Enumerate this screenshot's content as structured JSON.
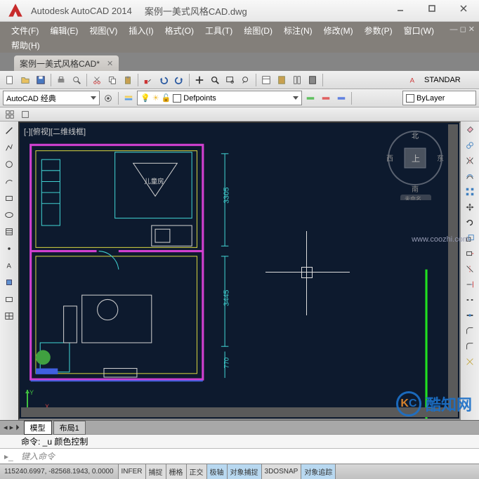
{
  "title": {
    "app": "Autodesk AutoCAD 2014",
    "file": "案例一美式风格CAD.dwg"
  },
  "menu": [
    "文件(F)",
    "编辑(E)",
    "视图(V)",
    "插入(I)",
    "格式(O)",
    "工具(T)",
    "绘图(D)",
    "标注(N)",
    "修改(M)",
    "参数(P)",
    "窗口(W)",
    "帮助(H)"
  ],
  "file_tab": {
    "name": "案例一美式风格CAD*"
  },
  "workspace": {
    "current": "AutoCAD 经典"
  },
  "layer": {
    "current": "Defpoints"
  },
  "color_combo": {
    "value": "ByLayer"
  },
  "style_combo": {
    "value": "STANDAR"
  },
  "view_label": "[-][俯视][二维线框]",
  "viewcube": {
    "n": "北",
    "s": "南",
    "e": "东",
    "w": "西",
    "face": "上",
    "label": "未命名"
  },
  "tabs": {
    "model": "模型",
    "layout1": "布局1"
  },
  "command": {
    "history": "命令: _u 颜色控制",
    "prompt": "键入命令"
  },
  "status": {
    "coords": "115240.6997, -82568.1943, 0.0000",
    "toggles": [
      {
        "label": "INFER",
        "on": false
      },
      {
        "label": "捕捉",
        "on": false
      },
      {
        "label": "栅格",
        "on": false
      },
      {
        "label": "正交",
        "on": false
      },
      {
        "label": "极轴",
        "on": true
      },
      {
        "label": "对象捕捉",
        "on": true
      },
      {
        "label": "3DOSNAP",
        "on": false
      },
      {
        "label": "对象追踪",
        "on": true
      }
    ]
  },
  "dimensions": {
    "d1": "3305",
    "d2": "3445",
    "d3": "770"
  },
  "drawing_labels": {
    "room1": "儿童房"
  },
  "watermark": {
    "brand": "酷知网",
    "url": "www.coozhi.com"
  }
}
